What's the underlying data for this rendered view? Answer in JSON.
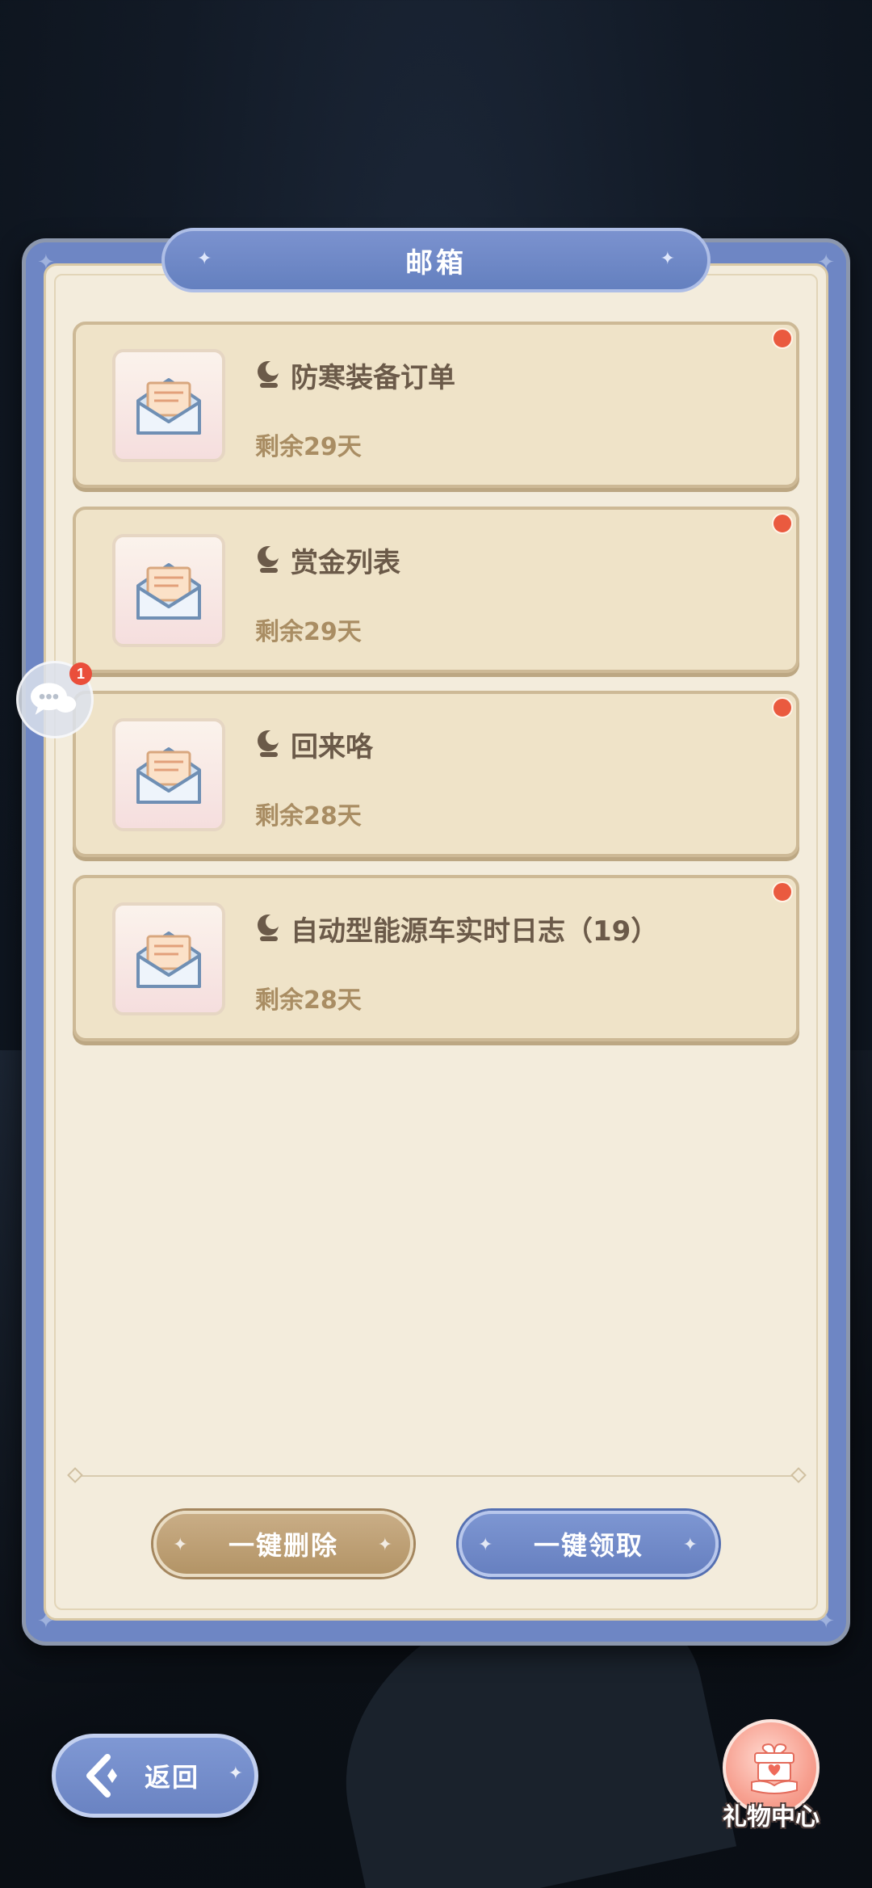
{
  "mailbox": {
    "title": "邮箱",
    "mails": [
      {
        "title": "防寒装备订单",
        "expire": "剩余29天",
        "unread": true,
        "type_icon": "moon-icon",
        "icon": "open-envelope-icon"
      },
      {
        "title": "赏金列表",
        "expire": "剩余29天",
        "unread": true,
        "type_icon": "moon-icon",
        "icon": "open-envelope-icon"
      },
      {
        "title": "回来咯",
        "expire": "剩余28天",
        "unread": true,
        "type_icon": "moon-icon",
        "icon": "open-envelope-icon"
      },
      {
        "title": "自动型能源车实时日志（19）",
        "expire": "剩余28天",
        "unread": true,
        "type_icon": "moon-icon",
        "icon": "open-envelope-icon"
      }
    ],
    "buttons": {
      "delete_all": "一键删除",
      "claim_all": "一键领取"
    }
  },
  "chat": {
    "badge": "1",
    "icon": "chat-bubbles-icon"
  },
  "navigation": {
    "back_label": "返回",
    "back_icon": "back-arrow-icon"
  },
  "gift_center": {
    "label": "礼物中心",
    "icon": "gift-heart-icon"
  },
  "colors": {
    "panel_border": "#6e86c4",
    "panel_bg": "#f3ecdc",
    "card_bg": "#efe3c8",
    "title_text": "#6b5a49",
    "expire_text": "#a98d63",
    "unread_dot": "#ea5a3f",
    "delete_button": "#b39466",
    "claim_button": "#6780c0"
  }
}
